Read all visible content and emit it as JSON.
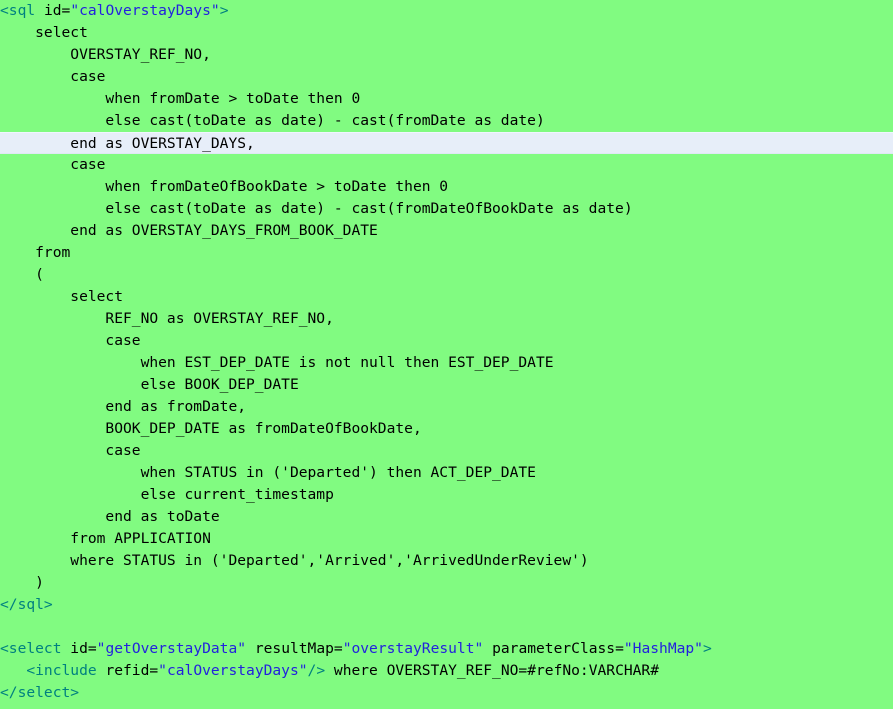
{
  "editor": {
    "background_color": "#81fb81",
    "highlight_color": "#e7eef9",
    "tag_color": "#008080",
    "value_color": "#2222dd",
    "text_color": "#000000",
    "language": "xml-sql",
    "highlighted_line_index": 6
  },
  "lines": [
    {
      "index": 0,
      "highlight": false,
      "tokens": [
        {
          "t": "tag",
          "s": "<sql"
        },
        {
          "t": "plain",
          "s": " id="
        },
        {
          "t": "value",
          "s": "\"calOverstayDays\""
        },
        {
          "t": "tag",
          "s": ">"
        }
      ]
    },
    {
      "index": 1,
      "highlight": false,
      "tokens": [
        {
          "t": "plain",
          "s": "    select"
        }
      ]
    },
    {
      "index": 2,
      "highlight": false,
      "tokens": [
        {
          "t": "plain",
          "s": "        OVERSTAY_REF_NO,"
        }
      ]
    },
    {
      "index": 3,
      "highlight": false,
      "tokens": [
        {
          "t": "plain",
          "s": "        case"
        }
      ]
    },
    {
      "index": 4,
      "highlight": false,
      "tokens": [
        {
          "t": "plain",
          "s": "            when fromDate > toDate then 0"
        }
      ]
    },
    {
      "index": 5,
      "highlight": false,
      "tokens": [
        {
          "t": "plain",
          "s": "            else cast(toDate as date) - cast(fromDate as date)"
        }
      ]
    },
    {
      "index": 6,
      "highlight": true,
      "tokens": [
        {
          "t": "plain",
          "s": "        end as OVERSTAY_DAYS,"
        }
      ]
    },
    {
      "index": 7,
      "highlight": false,
      "tokens": [
        {
          "t": "plain",
          "s": "        case"
        }
      ]
    },
    {
      "index": 8,
      "highlight": false,
      "tokens": [
        {
          "t": "plain",
          "s": "            when fromDateOfBookDate > toDate then 0"
        }
      ]
    },
    {
      "index": 9,
      "highlight": false,
      "tokens": [
        {
          "t": "plain",
          "s": "            else cast(toDate as date) - cast(fromDateOfBookDate as date)"
        }
      ]
    },
    {
      "index": 10,
      "highlight": false,
      "tokens": [
        {
          "t": "plain",
          "s": "        end as OVERSTAY_DAYS_FROM_BOOK_DATE"
        }
      ]
    },
    {
      "index": 11,
      "highlight": false,
      "tokens": [
        {
          "t": "plain",
          "s": "    from"
        }
      ]
    },
    {
      "index": 12,
      "highlight": false,
      "tokens": [
        {
          "t": "plain",
          "s": "    ("
        }
      ]
    },
    {
      "index": 13,
      "highlight": false,
      "tokens": [
        {
          "t": "plain",
          "s": "        select"
        }
      ]
    },
    {
      "index": 14,
      "highlight": false,
      "tokens": [
        {
          "t": "plain",
          "s": "            REF_NO as OVERSTAY_REF_NO,"
        }
      ]
    },
    {
      "index": 15,
      "highlight": false,
      "tokens": [
        {
          "t": "plain",
          "s": "            case"
        }
      ]
    },
    {
      "index": 16,
      "highlight": false,
      "tokens": [
        {
          "t": "plain",
          "s": "                when EST_DEP_DATE is not null then EST_DEP_DATE"
        }
      ]
    },
    {
      "index": 17,
      "highlight": false,
      "tokens": [
        {
          "t": "plain",
          "s": "                else BOOK_DEP_DATE"
        }
      ]
    },
    {
      "index": 18,
      "highlight": false,
      "tokens": [
        {
          "t": "plain",
          "s": "            end as fromDate,"
        }
      ]
    },
    {
      "index": 19,
      "highlight": false,
      "tokens": [
        {
          "t": "plain",
          "s": "            BOOK_DEP_DATE as fromDateOfBookDate,"
        }
      ]
    },
    {
      "index": 20,
      "highlight": false,
      "tokens": [
        {
          "t": "plain",
          "s": "            case"
        }
      ]
    },
    {
      "index": 21,
      "highlight": false,
      "tokens": [
        {
          "t": "plain",
          "s": "                when STATUS in ('Departed') then ACT_DEP_DATE"
        }
      ]
    },
    {
      "index": 22,
      "highlight": false,
      "tokens": [
        {
          "t": "plain",
          "s": "                else current_timestamp"
        }
      ]
    },
    {
      "index": 23,
      "highlight": false,
      "tokens": [
        {
          "t": "plain",
          "s": "            end as toDate"
        }
      ]
    },
    {
      "index": 24,
      "highlight": false,
      "tokens": [
        {
          "t": "plain",
          "s": "        from APPLICATION"
        }
      ]
    },
    {
      "index": 25,
      "highlight": false,
      "tokens": [
        {
          "t": "plain",
          "s": "        where STATUS in ('Departed','Arrived','ArrivedUnderReview')"
        }
      ]
    },
    {
      "index": 26,
      "highlight": false,
      "tokens": [
        {
          "t": "plain",
          "s": "    )"
        }
      ]
    },
    {
      "index": 27,
      "highlight": false,
      "tokens": [
        {
          "t": "tag",
          "s": "</sql>"
        }
      ]
    },
    {
      "index": 28,
      "highlight": false,
      "tokens": []
    },
    {
      "index": 29,
      "highlight": false,
      "tokens": [
        {
          "t": "tag",
          "s": "<select"
        },
        {
          "t": "plain",
          "s": " id="
        },
        {
          "t": "value",
          "s": "\"getOverstayData\""
        },
        {
          "t": "plain",
          "s": " resultMap="
        },
        {
          "t": "value",
          "s": "\"overstayResult\""
        },
        {
          "t": "plain",
          "s": " parameterClass="
        },
        {
          "t": "value",
          "s": "\"HashMap\""
        },
        {
          "t": "tag",
          "s": ">"
        }
      ]
    },
    {
      "index": 30,
      "highlight": false,
      "tokens": [
        {
          "t": "plain",
          "s": "   "
        },
        {
          "t": "tag",
          "s": "<include"
        },
        {
          "t": "plain",
          "s": " refid="
        },
        {
          "t": "value",
          "s": "\"calOverstayDays\""
        },
        {
          "t": "tag",
          "s": "/>"
        },
        {
          "t": "plain",
          "s": " where OVERSTAY_REF_NO=#refNo:VARCHAR#"
        }
      ]
    },
    {
      "index": 31,
      "highlight": false,
      "tokens": [
        {
          "t": "tag",
          "s": "</select>"
        }
      ]
    }
  ]
}
